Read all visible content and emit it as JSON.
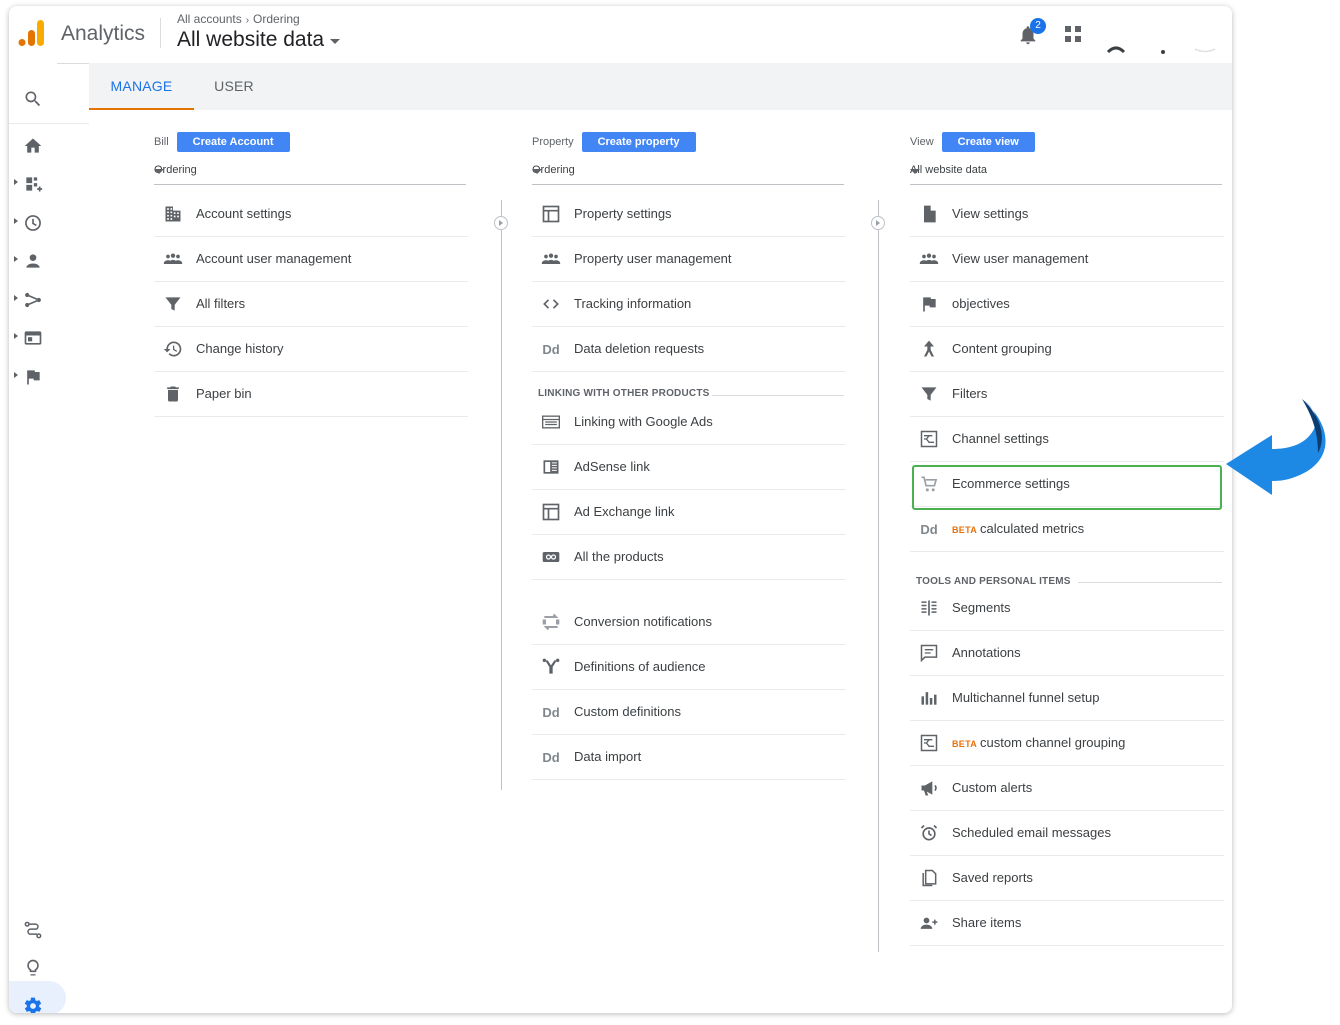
{
  "app": {
    "brand": "Analytics",
    "breadcrumb": [
      "All accounts",
      "Ordering"
    ],
    "view_name": "All website data",
    "notifications_count": "2"
  },
  "tabs": [
    {
      "label": "MANAGE",
      "active": true
    },
    {
      "label": "USER",
      "active": false
    }
  ],
  "account": {
    "label": "Bill",
    "create_label": "Create Account",
    "selected": "Ordering",
    "items": [
      {
        "icon": "building-icon",
        "label": "Account settings"
      },
      {
        "icon": "people-icon",
        "label": "Account user management"
      },
      {
        "icon": "filter-icon",
        "label": "All filters"
      },
      {
        "icon": "history-icon",
        "label": "Change history"
      },
      {
        "icon": "trash-icon",
        "label": "Paper bin"
      }
    ]
  },
  "property": {
    "label": "Property",
    "create_label": "Create property",
    "selected": "Ordering",
    "items": [
      {
        "icon": "window-icon",
        "label": "Property settings"
      },
      {
        "icon": "people-icon",
        "label": "Property user management"
      },
      {
        "icon": "code-icon",
        "label": "Tracking information"
      },
      {
        "icon": "dd-icon",
        "label": "Data deletion requests"
      }
    ],
    "linking_section": "LINKING WITH OTHER PRODUCTS",
    "linking_items": [
      {
        "icon": "ads-icon",
        "label": "Linking with Google Ads"
      },
      {
        "icon": "adsense-icon",
        "label": "AdSense link"
      },
      {
        "icon": "window-icon",
        "label": "Ad Exchange link"
      },
      {
        "icon": "link-box-icon",
        "label": "All the products"
      }
    ],
    "more_items": [
      {
        "icon": "postback-icon",
        "label": "Conversion notifications"
      },
      {
        "icon": "audience-icon",
        "label": "Definitions of audience"
      },
      {
        "icon": "dd-icon",
        "label": "Custom definitions"
      },
      {
        "icon": "dd-icon",
        "label": "Data import"
      }
    ]
  },
  "view": {
    "label": "View",
    "create_label": "Create view",
    "selected": "All website data",
    "items": [
      {
        "icon": "document-icon",
        "label": "View settings"
      },
      {
        "icon": "people-icon",
        "label": "View user management"
      },
      {
        "icon": "flag-icon",
        "label": "objectives"
      },
      {
        "icon": "person-run-icon",
        "label": "Content grouping"
      },
      {
        "icon": "filter-icon",
        "label": "Filters"
      },
      {
        "icon": "channel-icon",
        "label": "Channel settings"
      },
      {
        "icon": "cart-icon",
        "label": "Ecommerce settings"
      },
      {
        "icon": "dd-icon",
        "label": "calculated metrics",
        "beta": "BETA"
      }
    ],
    "tools_section": "TOOLS AND PERSONAL ITEMS",
    "tools_items": [
      {
        "icon": "segments-icon",
        "label": "Segments"
      },
      {
        "icon": "comment-icon",
        "label": "Annotations"
      },
      {
        "icon": "bar-chart-icon",
        "label": "Multichannel funnel setup"
      },
      {
        "icon": "channel-icon",
        "label": "custom channel grouping",
        "beta": "BETA"
      },
      {
        "icon": "megaphone-icon",
        "label": "Custom alerts"
      },
      {
        "icon": "alarm-icon",
        "label": "Scheduled email messages"
      },
      {
        "icon": "copy-icon",
        "label": "Saved reports"
      },
      {
        "icon": "person-add-icon",
        "label": "Share items"
      }
    ]
  },
  "colors": {
    "accent": "#1a73e8",
    "tab_underline": "#e37400",
    "create_button": "#4285f4",
    "highlight_border": "#4caf50",
    "beta": "#e8710a",
    "callout_arrow": "#1e88e5"
  },
  "dd_glyph": "Dd"
}
